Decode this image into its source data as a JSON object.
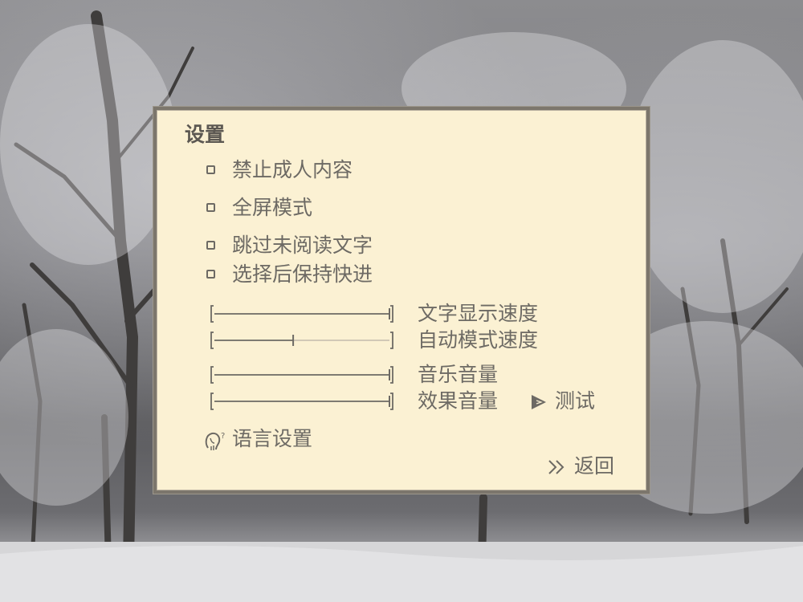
{
  "settings": {
    "title": "设置",
    "toggles": [
      {
        "label": "禁止成人内容",
        "checked": false
      },
      {
        "label": "全屏模式",
        "checked": false
      },
      {
        "label": "跳过未阅读文字",
        "checked": false
      },
      {
        "label": "选择后保持快进",
        "checked": false
      }
    ],
    "sliders": [
      {
        "label": "文字显示速度",
        "value": 1.0
      },
      {
        "label": "自动模式速度",
        "value": 0.45
      },
      {
        "label": "音乐音量",
        "value": 1.0
      },
      {
        "label": "效果音量",
        "value": 1.0
      }
    ],
    "test_label": "测试",
    "language_label": "语言设置",
    "back_label": "返回"
  },
  "colors": {
    "panel_bg": "#fbf1d3",
    "text": "#6d6a64",
    "border": "#7c766c"
  },
  "icons": {
    "test": "play-triangle-icon",
    "language": "language-head-icon",
    "back": "double-chevron-right-icon"
  }
}
